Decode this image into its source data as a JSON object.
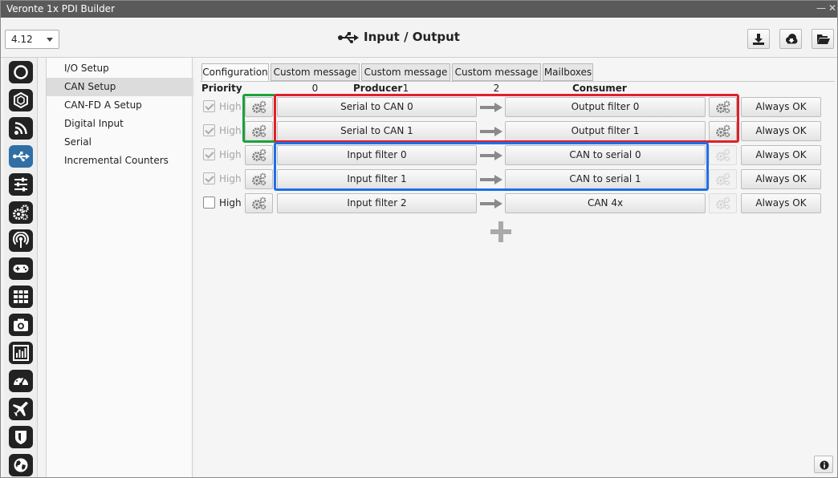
{
  "window": {
    "title": "Veronte 1x PDI Builder"
  },
  "toolbar": {
    "version": "4.12",
    "page_title": "Input / Output"
  },
  "menu": {
    "items": [
      {
        "label": "I/O Setup",
        "selected": false
      },
      {
        "label": "CAN Setup",
        "selected": true
      },
      {
        "label": "CAN-FD A Setup",
        "selected": false
      },
      {
        "label": "Digital Input",
        "selected": false
      },
      {
        "label": "Serial",
        "selected": false
      },
      {
        "label": "Incremental Counters",
        "selected": false
      }
    ]
  },
  "tabs": [
    {
      "label": "Configuration",
      "active": true
    },
    {
      "label": "Custom message 0",
      "active": false
    },
    {
      "label": "Custom message 1",
      "active": false
    },
    {
      "label": "Custom message 2",
      "active": false
    },
    {
      "label": "Mailboxes",
      "active": false
    }
  ],
  "headers": {
    "priority": "Priority",
    "producer": "Producer",
    "consumer": "Consumer"
  },
  "rows": [
    {
      "checked": true,
      "enabled": false,
      "priority_label": "High",
      "producer": "Serial to CAN 0",
      "consumer": "Output filter 0",
      "consumer_gear_enabled": true,
      "status": "Always OK"
    },
    {
      "checked": true,
      "enabled": false,
      "priority_label": "High",
      "producer": "Serial to CAN 1",
      "consumer": "Output filter 1",
      "consumer_gear_enabled": true,
      "status": "Always OK"
    },
    {
      "checked": true,
      "enabled": false,
      "priority_label": "High",
      "producer": "Input filter 0",
      "consumer": "CAN to serial 0",
      "consumer_gear_enabled": false,
      "status": "Always OK"
    },
    {
      "checked": true,
      "enabled": false,
      "priority_label": "High",
      "producer": "Input filter 1",
      "consumer": "CAN to serial 1",
      "consumer_gear_enabled": false,
      "status": "Always OK"
    },
    {
      "checked": false,
      "enabled": true,
      "priority_label": "High",
      "producer": "Input filter 2",
      "consumer": "CAN 4x",
      "consumer_gear_enabled": false,
      "status": "Always OK"
    }
  ],
  "highlight_colors": {
    "green": "#1aa33a",
    "red": "#e0202a",
    "blue": "#1f6fe6"
  },
  "icons": {
    "sidebar": [
      "circle-icon",
      "hexagon-icon",
      "rss-icon",
      "usb-icon",
      "sliders-icon",
      "gears-icon",
      "antenna-icon",
      "gamepad-icon",
      "grid-icon",
      "camera-icon",
      "chart-icon",
      "gauge-icon",
      "plane-icon",
      "shield-icon",
      "globe-icon"
    ]
  }
}
